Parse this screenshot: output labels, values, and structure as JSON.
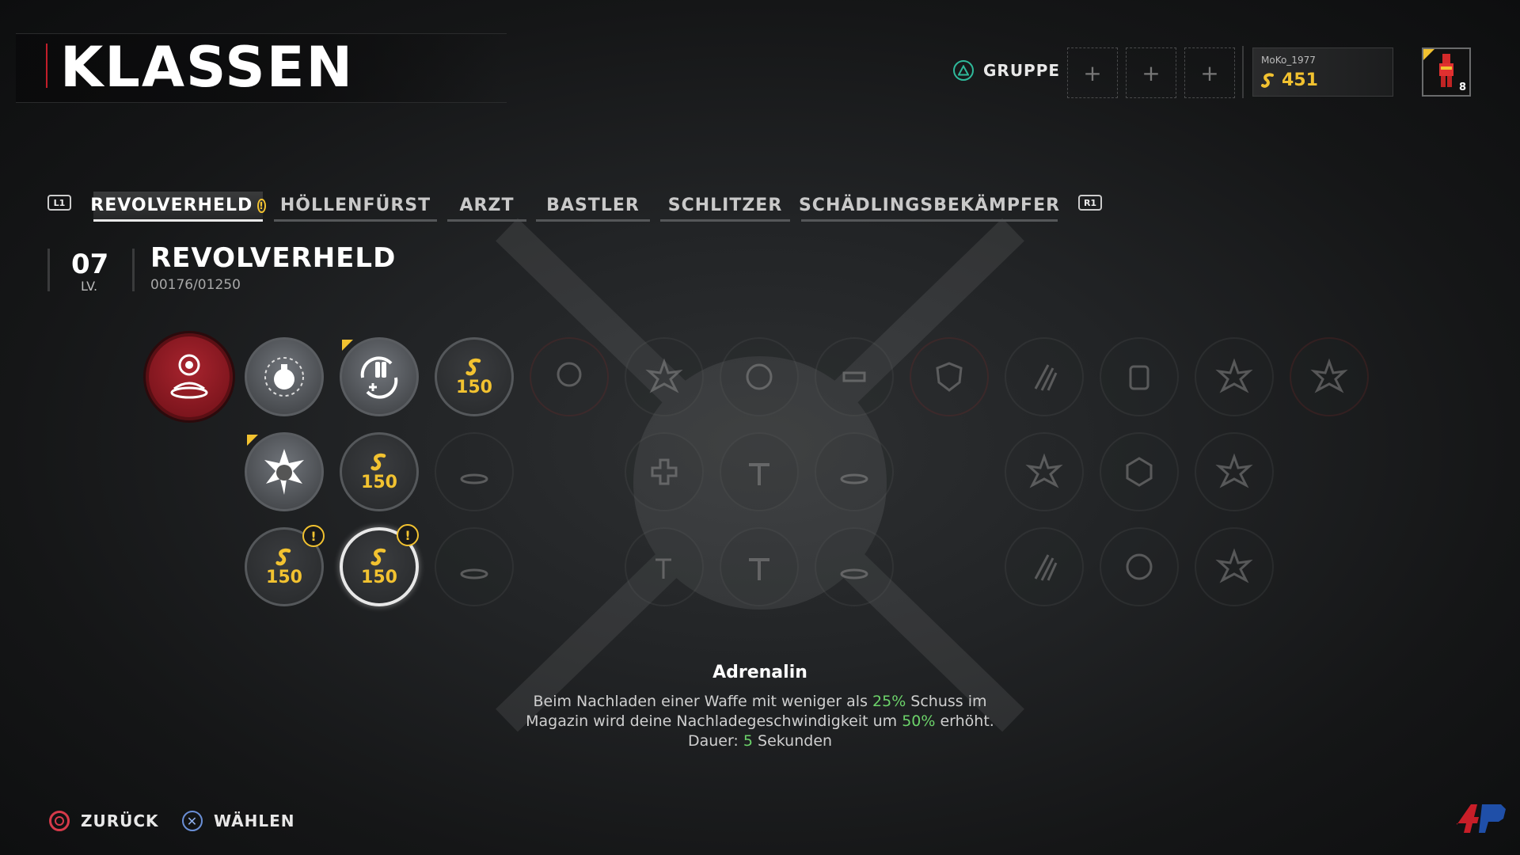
{
  "header": {
    "title": "KLASSEN"
  },
  "party": {
    "label": "GRUPPE",
    "slots": [
      "+",
      "+",
      "+"
    ],
    "player": {
      "name": "MoKo_1977",
      "coins": "451",
      "level": "8"
    }
  },
  "tabs": {
    "prev_button": "L1",
    "next_button": "R1",
    "items": [
      {
        "label": "REVOLVERHELD",
        "active": true,
        "alert": "!"
      },
      {
        "label": "HÖLLENFÜRST"
      },
      {
        "label": "ARZT"
      },
      {
        "label": "BASTLER"
      },
      {
        "label": "SCHLITZER"
      },
      {
        "label": "SCHÄDLINGSBEKÄMPFER"
      }
    ]
  },
  "class_info": {
    "level": "07",
    "level_label": "LV.",
    "name": "REVOLVERHELD",
    "xp": "00176/01250"
  },
  "skills": {
    "cost": "150",
    "alert": "!"
  },
  "description": {
    "title": "Adrenalin",
    "line1_a": "Beim Nachladen einer Waffe mit weniger als ",
    "line1_hl": "25%",
    "line1_b": " Schuss im",
    "line2_a": "Magazin wird deine Nachladegeschwindigkeit um ",
    "line2_hl": "50%",
    "line2_b": " erhöht.",
    "line3_a": "Dauer: ",
    "line3_hl": "5",
    "line3_b": " Sekunden"
  },
  "footer": {
    "back_label": "ZURÜCK",
    "select_label": "WÄHLEN"
  },
  "colors": {
    "accent_gold": "#f2c230",
    "highlight_green": "#6cd36a",
    "primary_red": "#a8242e",
    "triangle_green": "#2fb89a"
  }
}
